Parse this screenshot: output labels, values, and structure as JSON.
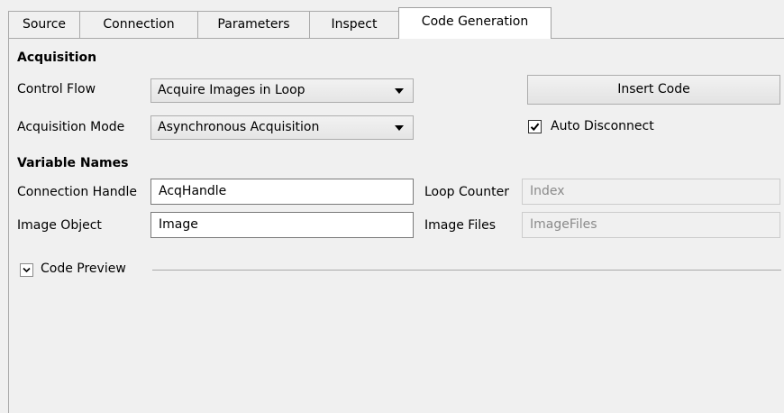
{
  "tabs": [
    {
      "label": "Source"
    },
    {
      "label": "Connection"
    },
    {
      "label": "Parameters"
    },
    {
      "label": "Inspect"
    },
    {
      "label": "Code Generation",
      "active": true
    }
  ],
  "acquisition": {
    "heading": "Acquisition",
    "control_flow_label": "Control Flow",
    "control_flow_value": "Acquire Images in Loop",
    "mode_label": "Acquisition Mode",
    "mode_value": "Asynchronous Acquisition",
    "insert_code_label": "Insert Code",
    "auto_disconnect_label": "Auto Disconnect",
    "auto_disconnect_checked": true
  },
  "variables": {
    "heading": "Variable Names",
    "connection_handle_label": "Connection Handle",
    "connection_handle_value": "AcqHandle",
    "image_object_label": "Image Object",
    "image_object_value": "Image",
    "loop_counter_label": "Loop Counter",
    "loop_counter_value": "Index",
    "image_files_label": "Image Files",
    "image_files_value": "ImageFiles"
  },
  "preview": {
    "label": "Code Preview",
    "expanded": true
  }
}
